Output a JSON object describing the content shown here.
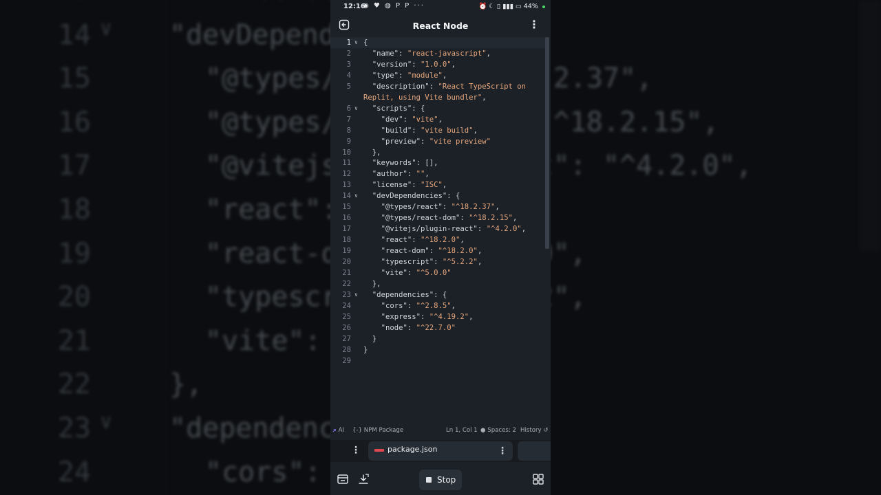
{
  "background": {
    "lines": [
      {
        "num": "15",
        "code": "\"license\": \"ISC\",",
        "indent": 1
      },
      {
        "num": "14",
        "code": "\"devDependencies\": {",
        "indent": 0,
        "fold": true
      },
      {
        "num": "15",
        "code": "\"@types/react\": \"^18.2.37\",",
        "indent": 1
      },
      {
        "num": "16",
        "code": "\"@types/react-dom\": \"^18.2.15\",",
        "indent": 1
      },
      {
        "num": "17",
        "code": "\"@vitejs/plugin-react\": \"^4.2.0\",",
        "indent": 1
      },
      {
        "num": "18",
        "code": "\"react\": \"^18.2.0\",",
        "indent": 1
      },
      {
        "num": "19",
        "code": "\"react-dom\": \"^18.2.0\",",
        "indent": 1
      },
      {
        "num": "20",
        "code": "\"typescript\": \"^5.2.2\",",
        "indent": 1
      },
      {
        "num": "21",
        "code": "\"vite\": \"^5.0.0\"",
        "indent": 1
      },
      {
        "num": "22",
        "code": "},",
        "indent": 0
      },
      {
        "num": "23",
        "code": "\"dependencies\": {",
        "indent": 0,
        "fold": true
      },
      {
        "num": "24",
        "code": "\"cors\": \"^2.8.5\",",
        "indent": 1
      }
    ]
  },
  "status_bar": {
    "time": "12:16",
    "left_icons": "◉ ♥ ◍ P P ···",
    "right_icons": "⏰ ☾ ▯ ▮▮▮ ▭",
    "battery": "44%"
  },
  "header": {
    "title": "React Node"
  },
  "editor": {
    "lines": [
      {
        "n": "1",
        "fold": true,
        "indent": 0,
        "parts": [
          [
            "p",
            "{"
          ]
        ]
      },
      {
        "n": "2",
        "indent": 1,
        "parts": [
          [
            "k",
            "\"name\""
          ],
          [
            "p",
            ": "
          ],
          [
            "s",
            "\"react-javascript\""
          ],
          [
            "p",
            ","
          ]
        ]
      },
      {
        "n": "3",
        "indent": 1,
        "parts": [
          [
            "k",
            "\"version\""
          ],
          [
            "p",
            ": "
          ],
          [
            "s",
            "\"1.0.0\""
          ],
          [
            "p",
            ","
          ]
        ]
      },
      {
        "n": "4",
        "indent": 1,
        "parts": [
          [
            "k",
            "\"type\""
          ],
          [
            "p",
            ": "
          ],
          [
            "s",
            "\"module\""
          ],
          [
            "p",
            ","
          ]
        ]
      },
      {
        "n": "5",
        "indent": 1,
        "parts": [
          [
            "k",
            "\"description\""
          ],
          [
            "p",
            ": "
          ],
          [
            "s",
            "\"React TypeScript on"
          ]
        ]
      },
      {
        "n": "",
        "indent": 0,
        "parts": [
          [
            "s",
            "Replit, using Vite bundler\""
          ],
          [
            "p",
            ","
          ]
        ]
      },
      {
        "n": "6",
        "fold": true,
        "indent": 1,
        "parts": [
          [
            "k",
            "\"scripts\""
          ],
          [
            "p",
            ": {"
          ]
        ]
      },
      {
        "n": "7",
        "indent": 2,
        "parts": [
          [
            "k",
            "\"dev\""
          ],
          [
            "p",
            ": "
          ],
          [
            "s",
            "\"vite\""
          ],
          [
            "p",
            ","
          ]
        ]
      },
      {
        "n": "8",
        "indent": 2,
        "parts": [
          [
            "k",
            "\"build\""
          ],
          [
            "p",
            ": "
          ],
          [
            "s",
            "\"vite build\""
          ],
          [
            "p",
            ","
          ]
        ]
      },
      {
        "n": "9",
        "indent": 2,
        "parts": [
          [
            "k",
            "\"preview\""
          ],
          [
            "p",
            ": "
          ],
          [
            "s",
            "\"vite preview\""
          ]
        ]
      },
      {
        "n": "10",
        "indent": 1,
        "parts": [
          [
            "p",
            "},"
          ]
        ]
      },
      {
        "n": "11",
        "indent": 1,
        "parts": [
          [
            "k",
            "\"keywords\""
          ],
          [
            "p",
            ": [],"
          ]
        ]
      },
      {
        "n": "12",
        "indent": 1,
        "parts": [
          [
            "k",
            "\"author\""
          ],
          [
            "p",
            ": "
          ],
          [
            "s",
            "\"\""
          ],
          [
            "p",
            ","
          ]
        ]
      },
      {
        "n": "13",
        "indent": 1,
        "parts": [
          [
            "k",
            "\"license\""
          ],
          [
            "p",
            ": "
          ],
          [
            "s",
            "\"ISC\""
          ],
          [
            "p",
            ","
          ]
        ]
      },
      {
        "n": "14",
        "fold": true,
        "indent": 1,
        "parts": [
          [
            "k",
            "\"devDependencies\""
          ],
          [
            "p",
            ": {"
          ]
        ]
      },
      {
        "n": "15",
        "indent": 2,
        "parts": [
          [
            "k",
            "\"@types/react\""
          ],
          [
            "p",
            ": "
          ],
          [
            "s",
            "\"^18.2.37\""
          ],
          [
            "p",
            ","
          ]
        ]
      },
      {
        "n": "16",
        "indent": 2,
        "parts": [
          [
            "k",
            "\"@types/react-dom\""
          ],
          [
            "p",
            ": "
          ],
          [
            "s",
            "\"^18.2.15\""
          ],
          [
            "p",
            ","
          ]
        ]
      },
      {
        "n": "17",
        "indent": 2,
        "parts": [
          [
            "k",
            "\"@vitejs/plugin-react\""
          ],
          [
            "p",
            ": "
          ],
          [
            "s",
            "\"^4.2.0\""
          ],
          [
            "p",
            ","
          ]
        ]
      },
      {
        "n": "18",
        "indent": 2,
        "parts": [
          [
            "k",
            "\"react\""
          ],
          [
            "p",
            ": "
          ],
          [
            "s",
            "\"^18.2.0\""
          ],
          [
            "p",
            ","
          ]
        ]
      },
      {
        "n": "19",
        "indent": 2,
        "parts": [
          [
            "k",
            "\"react-dom\""
          ],
          [
            "p",
            ": "
          ],
          [
            "s",
            "\"^18.2.0\""
          ],
          [
            "p",
            ","
          ]
        ]
      },
      {
        "n": "20",
        "indent": 2,
        "parts": [
          [
            "k",
            "\"typescript\""
          ],
          [
            "p",
            ": "
          ],
          [
            "s",
            "\"^5.2.2\""
          ],
          [
            "p",
            ","
          ]
        ]
      },
      {
        "n": "21",
        "indent": 2,
        "parts": [
          [
            "k",
            "\"vite\""
          ],
          [
            "p",
            ": "
          ],
          [
            "s",
            "\"^5.0.0\""
          ]
        ]
      },
      {
        "n": "22",
        "indent": 1,
        "parts": [
          [
            "p",
            "},"
          ]
        ]
      },
      {
        "n": "23",
        "fold": true,
        "indent": 1,
        "parts": [
          [
            "k",
            "\"dependencies\""
          ],
          [
            "p",
            ": {"
          ]
        ]
      },
      {
        "n": "24",
        "indent": 2,
        "parts": [
          [
            "k",
            "\"cors\""
          ],
          [
            "p",
            ": "
          ],
          [
            "s",
            "\"^2.8.5\""
          ],
          [
            "p",
            ","
          ]
        ]
      },
      {
        "n": "25",
        "indent": 2,
        "parts": [
          [
            "k",
            "\"express\""
          ],
          [
            "p",
            ": "
          ],
          [
            "s",
            "\"^4.19.2\""
          ],
          [
            "p",
            ","
          ]
        ]
      },
      {
        "n": "26",
        "indent": 2,
        "parts": [
          [
            "k",
            "\"node\""
          ],
          [
            "p",
            ": "
          ],
          [
            "s",
            "\"^22.7.0\""
          ]
        ]
      },
      {
        "n": "27",
        "indent": 1,
        "parts": [
          [
            "p",
            "}"
          ]
        ]
      },
      {
        "n": "28",
        "indent": 0,
        "parts": [
          [
            "p",
            "}"
          ]
        ]
      },
      {
        "n": "29",
        "indent": 0,
        "parts": []
      }
    ]
  },
  "editor_status": {
    "ai": "AI",
    "language": "NPM Package",
    "cursor": "Ln 1, Col 1",
    "spaces": "Spaces: 2",
    "history": "History"
  },
  "tabs": {
    "active_file": "package.json"
  },
  "bottom": {
    "stop_label": "Stop"
  },
  "colors": {
    "string": "#e8a87c",
    "background": "#1c2128",
    "accent_red": "#e0484f"
  }
}
